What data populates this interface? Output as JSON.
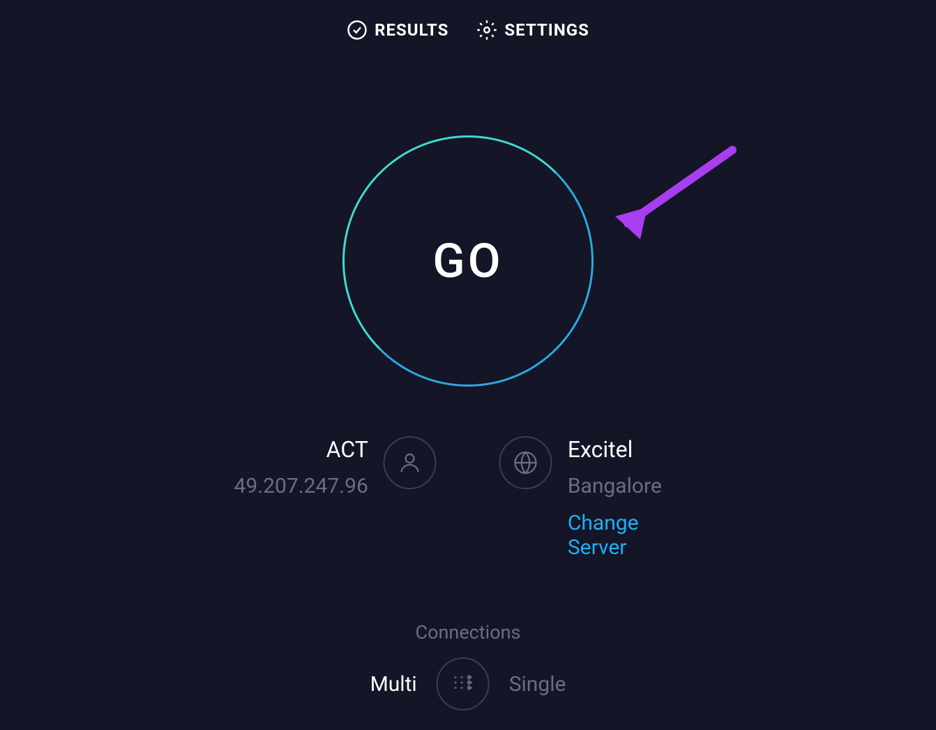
{
  "nav": {
    "results_label": "RESULTS",
    "settings_label": "SETTINGS"
  },
  "go_button": {
    "label": "GO"
  },
  "isp": {
    "name": "ACT",
    "ip": "49.207.247.96"
  },
  "server": {
    "name": "Excitel",
    "location": "Bangalore",
    "change_label": "Change Server"
  },
  "connections": {
    "label": "Connections",
    "multi_label": "Multi",
    "single_label": "Single",
    "active_mode": "Multi"
  },
  "colors": {
    "background": "#141526",
    "accent_teal": "#3fd9d0",
    "accent_blue": "#1cb0f6",
    "muted": "#6b6d85",
    "arrow": "#a93ef0"
  }
}
